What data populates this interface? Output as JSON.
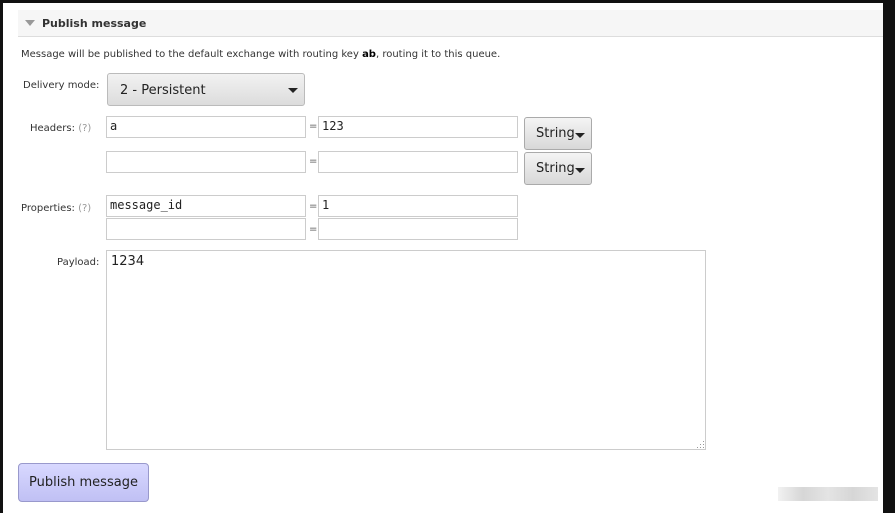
{
  "section": {
    "title": "Publish message"
  },
  "intro": {
    "before": "Message will be published to the default exchange with routing key ",
    "key": "ab",
    "after": ", routing it to this queue."
  },
  "delivery_mode": {
    "label": "Delivery mode:",
    "value": "2 - Persistent"
  },
  "headers": {
    "label": "Headers:",
    "help": "(?)",
    "rows": [
      {
        "key": "a",
        "value": "123",
        "type": "String"
      },
      {
        "key": "",
        "value": "",
        "type": "String"
      }
    ]
  },
  "properties": {
    "label": "Properties:",
    "help": "(?)",
    "rows": [
      {
        "key": "message_id",
        "value": "1"
      },
      {
        "key": "",
        "value": ""
      }
    ]
  },
  "equals": "=",
  "payload": {
    "label": "Payload:",
    "value": "1234"
  },
  "publish_button": "Publish message"
}
